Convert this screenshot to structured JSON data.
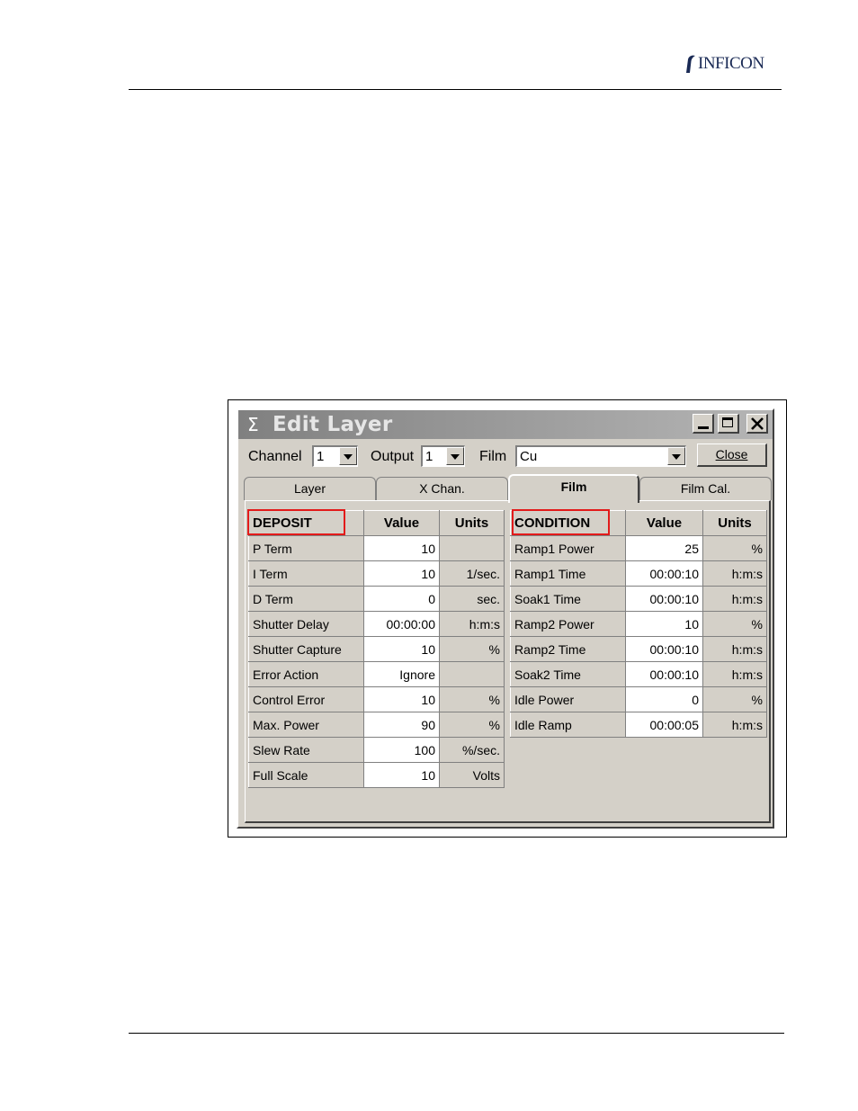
{
  "brand": {
    "name": "INFICON"
  },
  "window": {
    "title": "Edit Layer",
    "title_icon": "sigma-icon"
  },
  "toolbar": {
    "channel_label": "Channel",
    "channel_value": "1",
    "output_label": "Output",
    "output_value": "1",
    "film_label": "Film",
    "film_value": "Cu",
    "close_label": "Close"
  },
  "tabs": [
    {
      "label": "Layer",
      "active": false
    },
    {
      "label": "X Chan.",
      "active": false
    },
    {
      "label": "Film",
      "active": true
    },
    {
      "label": "Film Cal.",
      "active": false
    }
  ],
  "deposit": {
    "headers": [
      "DEPOSIT",
      "Value",
      "Units"
    ],
    "rows": [
      [
        "P Term",
        "10",
        ""
      ],
      [
        "I Term",
        "10",
        "1/sec."
      ],
      [
        "D Term",
        "0",
        "sec."
      ],
      [
        "Shutter Delay",
        "00:00:00",
        "h:m:s"
      ],
      [
        "Shutter Capture",
        "10",
        "%"
      ],
      [
        "Error Action",
        "Ignore",
        ""
      ],
      [
        "Control Error",
        "10",
        "%"
      ],
      [
        "Max. Power",
        "90",
        "%"
      ],
      [
        "Slew Rate",
        "100",
        "%/sec."
      ],
      [
        "Full Scale",
        "10",
        "Volts"
      ]
    ]
  },
  "condition": {
    "headers": [
      "CONDITION",
      "Value",
      "Units"
    ],
    "rows": [
      [
        "Ramp1 Power",
        "25",
        "%"
      ],
      [
        "Ramp1 Time",
        "00:00:10",
        "h:m:s"
      ],
      [
        "Soak1 Time",
        "00:00:10",
        "h:m:s"
      ],
      [
        "Ramp2 Power",
        "10",
        "%"
      ],
      [
        "Ramp2 Time",
        "00:00:10",
        "h:m:s"
      ],
      [
        "Soak2 Time",
        "00:00:10",
        "h:m:s"
      ],
      [
        "Idle Power",
        "0",
        "%"
      ],
      [
        "Idle Ramp",
        "00:00:05",
        "h:m:s"
      ]
    ]
  },
  "colors": {
    "highlight": "#e21a1a",
    "face": "#d4d0c8"
  }
}
